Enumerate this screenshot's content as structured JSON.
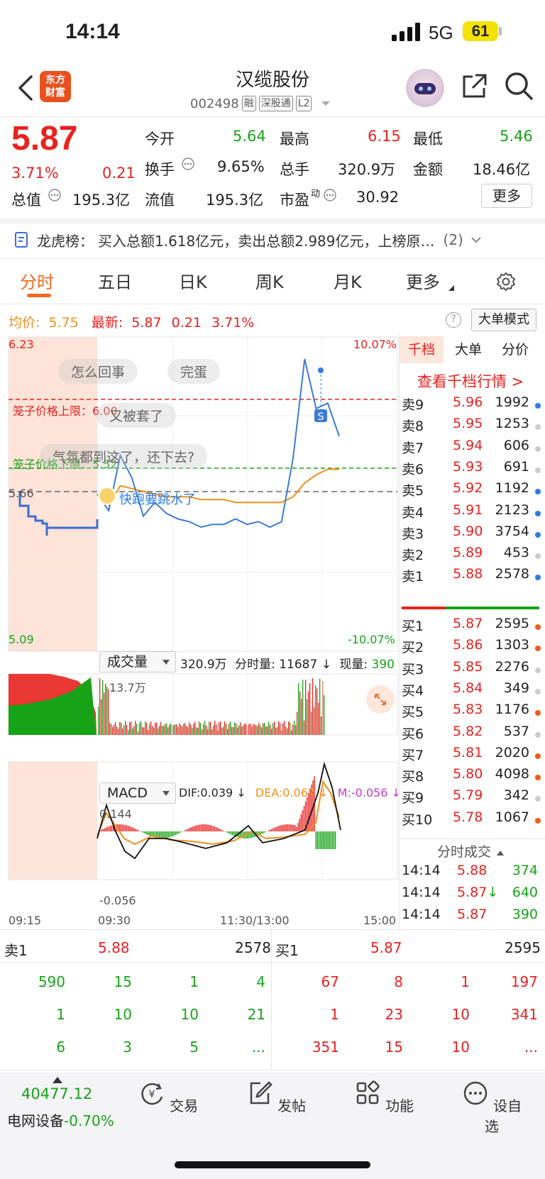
{
  "status": {
    "time": "14:14",
    "network": "5G",
    "battery": "61"
  },
  "header": {
    "title": "汉缆股份",
    "code": "002498",
    "tags": [
      "融",
      "深股通",
      "L2"
    ],
    "logo_text": [
      "东方",
      "财富"
    ]
  },
  "quote": {
    "price": "5.87",
    "change_pct": "3.71%",
    "change": "0.21",
    "open_label": "今开",
    "open": "5.64",
    "high_label": "最高",
    "high": "6.15",
    "low_label": "最低",
    "low": "5.46",
    "turnover_label": "换手",
    "turnover": "9.65%",
    "volume_label": "总手",
    "volume": "320.9万",
    "amount_label": "金额",
    "amount": "18.46亿",
    "mktcap_label": "总值",
    "mktcap": "195.3亿",
    "float_label": "流值",
    "float": "195.3亿",
    "pe_label": "市盈",
    "pe_sup": "动",
    "pe": "30.92",
    "more": "更多"
  },
  "dragon": {
    "label": "龙虎榜：",
    "text": "买入总额1.618亿元，卖出总额2.989亿元，上榜原…",
    "count": "(2)"
  },
  "tabs": [
    "分时",
    "五日",
    "日K",
    "周K",
    "月K",
    "更多"
  ],
  "info": {
    "avg_label": "均价:",
    "avg": "5.75",
    "latest_label": "最新:",
    "latest": "5.87",
    "chg": "0.21",
    "pct": "3.71%",
    "help": "?",
    "mode": "大单模式"
  },
  "chart": {
    "y_top": "6.23",
    "y_bottom": "5.09",
    "pct_top": "10.07%",
    "pct_bottom": "-10.07%",
    "prev_close": "5.66",
    "upper_limit": "笼子价格上限：6.00",
    "lower_limit": "笼子价格下限：5.52",
    "bubbles": [
      "怎么回事",
      "完蛋",
      "又被套了",
      "气氛都到这了，还下去?"
    ],
    "annot": "快跑要跳水了",
    "s_mark": "S",
    "vol_title": "成交量",
    "vol_info": "320.9万",
    "vol_tick_label": "分时量:",
    "vol_tick": "11687",
    "vol_now_label": "现量:",
    "vol_now": "390",
    "vol_max": "13.7万",
    "macd_title": "MACD",
    "dif": "DIF:0.039",
    "dea": "DEA:0.067",
    "m": "M:-0.056",
    "macd_top": "0.144",
    "macd_bottom": "-0.056",
    "times": [
      "09:15",
      "09:30",
      "11:30/13:00",
      "15:00"
    ]
  },
  "chart_data": {
    "type": "line",
    "title": "分时",
    "ylim": [
      5.09,
      6.23
    ],
    "prev_close": 5.66,
    "series": [
      {
        "name": "价格",
        "values": [
          5.66,
          5.6,
          5.8,
          5.72,
          5.58,
          5.63,
          5.59,
          5.57,
          5.56,
          5.54,
          5.55,
          5.55,
          5.57,
          5.55,
          5.56,
          5.54,
          5.56,
          5.79,
          6.15,
          5.97,
          5.99,
          5.87
        ]
      },
      {
        "name": "均价",
        "values": [
          5.66,
          5.62,
          5.69,
          5.68,
          5.67,
          5.66,
          5.65,
          5.65,
          5.65,
          5.64,
          5.64,
          5.64,
          5.63,
          5.63,
          5.63,
          5.63,
          5.63,
          5.65,
          5.7,
          5.73,
          5.75,
          5.75
        ]
      }
    ]
  },
  "orderbook": {
    "tabs": [
      "千档",
      "大单",
      "分价"
    ],
    "link": "查看千档行情 >",
    "asks": [
      {
        "label": "卖9",
        "price": "5.96",
        "vol": "1992",
        "dot": "#2b7de0"
      },
      {
        "label": "卖8",
        "price": "5.95",
        "vol": "1253",
        "dot": "#cccccc"
      },
      {
        "label": "卖7",
        "price": "5.94",
        "vol": "606",
        "dot": "#cccccc"
      },
      {
        "label": "卖6",
        "price": "5.93",
        "vol": "691",
        "dot": "#cccccc"
      },
      {
        "label": "卖5",
        "price": "5.92",
        "vol": "1192",
        "dot": "#2b7de0"
      },
      {
        "label": "卖4",
        "price": "5.91",
        "vol": "2123",
        "dot": "#2b7de0"
      },
      {
        "label": "卖3",
        "price": "5.90",
        "vol": "3754",
        "dot": "#2b7de0"
      },
      {
        "label": "卖2",
        "price": "5.89",
        "vol": "453",
        "dot": "#cccccc"
      },
      {
        "label": "卖1",
        "price": "5.88",
        "vol": "2578",
        "dot": "#2b7de0"
      }
    ],
    "bids": [
      {
        "label": "买1",
        "price": "5.87",
        "vol": "2595",
        "dot": "#f05a1a"
      },
      {
        "label": "买2",
        "price": "5.86",
        "vol": "1303",
        "dot": "#f05a1a"
      },
      {
        "label": "买3",
        "price": "5.85",
        "vol": "2276",
        "dot": "#cccccc"
      },
      {
        "label": "买4",
        "price": "5.84",
        "vol": "349",
        "dot": "#cccccc"
      },
      {
        "label": "买5",
        "price": "5.83",
        "vol": "1176",
        "dot": "#f05a1a"
      },
      {
        "label": "买6",
        "price": "5.82",
        "vol": "537",
        "dot": "#cccccc"
      },
      {
        "label": "买7",
        "price": "5.81",
        "vol": "2020",
        "dot": "#f05a1a"
      },
      {
        "label": "买8",
        "price": "5.80",
        "vol": "4098",
        "dot": "#f05a1a"
      },
      {
        "label": "买9",
        "price": "5.79",
        "vol": "342",
        "dot": "#cccccc"
      },
      {
        "label": "买10",
        "price": "5.78",
        "vol": "1067",
        "dot": "#f05a1a"
      }
    ],
    "trades_title": "分时成交",
    "trades": [
      {
        "time": "14:14",
        "price": "5.88",
        "vol": "374",
        "arrow": ""
      },
      {
        "time": "14:14",
        "price": "5.87",
        "vol": "640",
        "arrow": "↓"
      },
      {
        "time": "14:14",
        "price": "5.87",
        "vol": "390",
        "arrow": ""
      }
    ]
  },
  "queue": {
    "sell_label": "卖1",
    "sell_price": "5.88",
    "sell_vol": "2578",
    "buy_label": "买1",
    "buy_price": "5.87",
    "buy_vol": "2595",
    "sell_rows": [
      [
        "590",
        "15",
        "1",
        "4"
      ],
      [
        "1",
        "10",
        "10",
        "21"
      ],
      [
        "6",
        "3",
        "5",
        "..."
      ]
    ],
    "buy_rows": [
      [
        "67",
        "8",
        "1",
        "197"
      ],
      [
        "1",
        "23",
        "10",
        "341"
      ],
      [
        "351",
        "15",
        "10",
        "..."
      ]
    ]
  },
  "nav": {
    "index_value": "40477.12",
    "index_name": "电网设备",
    "index_pct": "-0.70%",
    "items": [
      "交易",
      "发帖",
      "功能",
      "设自选"
    ]
  }
}
